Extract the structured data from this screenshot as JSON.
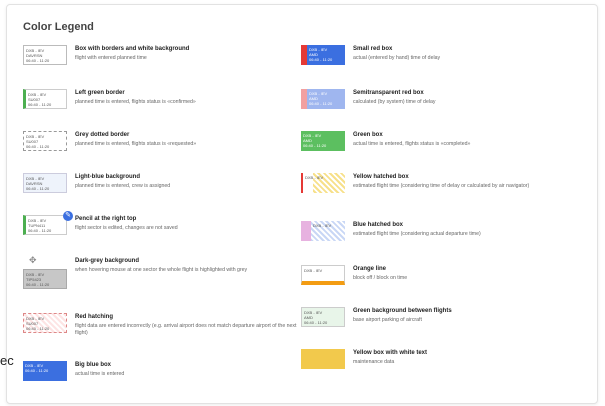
{
  "title": "Color Legend",
  "cut_text": "ec",
  "flight": {
    "route": "DXB - IEV",
    "time": "06:40 - 11:20",
    "reg1": "DAVRSN",
    "reg2": "SU007",
    "reg3": "TUPN411",
    "reg4": "TIP5423",
    "arr": "AMD"
  },
  "left": [
    {
      "label": "Box with borders and white background",
      "desc": "flight with entered planned time"
    },
    {
      "label": "Left green border",
      "desc": "planned time is entered, flights status is «confirmed»"
    },
    {
      "label": "Grey dotted border",
      "desc": "planned time is entered, flights status is «requested»"
    },
    {
      "label": "Light-blue background",
      "desc": "planned time is entered, crew is assigned"
    },
    {
      "label": "Pencil at the right top",
      "desc": "flight sector is edited, changes are not saved"
    },
    {
      "label": "Dark-grey background",
      "desc": "when hovering mouse at one sector the whole flight is highlighted with grey"
    },
    {
      "label": "Red hatching",
      "desc": "flight data are entered incorrectly (e.g. arrival airport does not match departure airport of the next flight)"
    },
    {
      "label": "Big blue box",
      "desc": "actual time is entered"
    }
  ],
  "right": [
    {
      "label": "Small red box",
      "desc": "actual (entered by hand) time of delay"
    },
    {
      "label": "Semitransparent red box",
      "desc": "calculated (by system) time of delay"
    },
    {
      "label": "Green box",
      "desc": "actual time is entered, flights status is «completed»"
    },
    {
      "label": "Yellow hatched box",
      "desc": "estimated flight time (considering time of delay or calculated by air navigator)"
    },
    {
      "label": "Blue hatched box",
      "desc": "estimated flight time (considering actual departure time)"
    },
    {
      "label": "Orange line",
      "desc": "block off / block on time"
    },
    {
      "label": "Green background between flights",
      "desc": "base airport parking of aircraft"
    },
    {
      "label": "Yellow box with white text",
      "desc": "maintenance data"
    }
  ],
  "colors": {
    "accent_blue": "#3b6fe0",
    "green": "#4caf50",
    "red": "#e53935",
    "orange": "#f39c12",
    "yellow": "#f2c94c",
    "grey": "#bdbdbd"
  }
}
